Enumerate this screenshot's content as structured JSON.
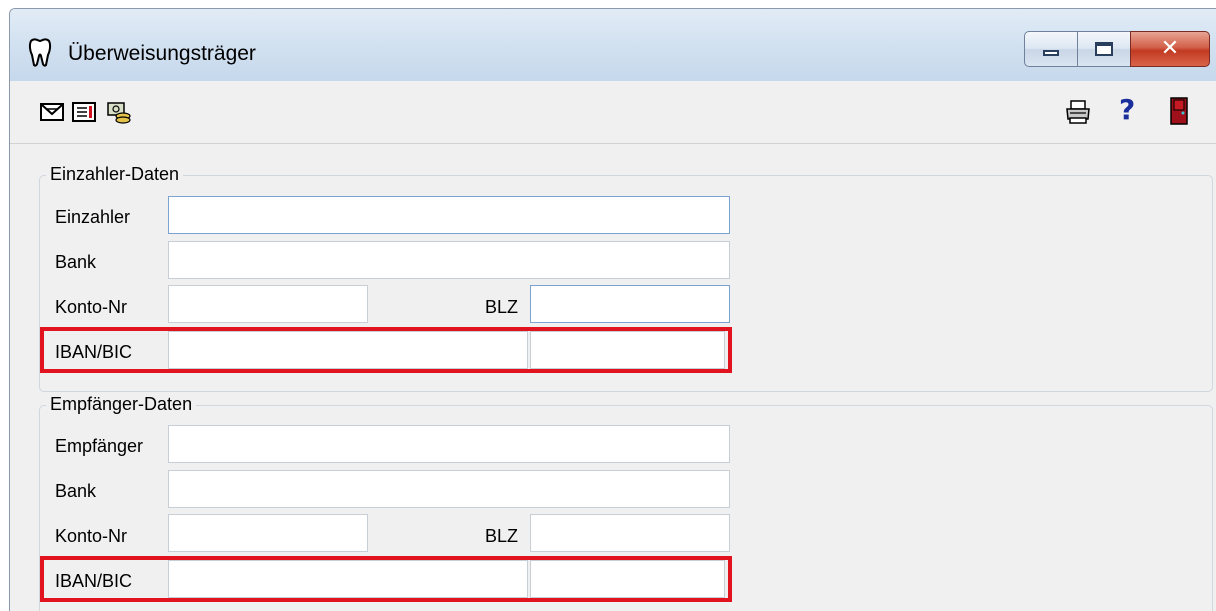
{
  "window": {
    "title": "Überweisungsträger",
    "icon": "tooth-icon",
    "controls": {
      "minimize": "minimize-icon",
      "maximize": "maximize-icon",
      "close": "✕"
    }
  },
  "toolbar": {
    "left_icons": [
      "envelope-icon",
      "document-icon",
      "money-icon"
    ],
    "right_icons": [
      "printer-icon",
      "help-icon",
      "exit-door-icon"
    ],
    "help_glyph": "?"
  },
  "payer": {
    "group_title": "Einzahler-Daten",
    "name_label": "Einzahler",
    "name_value": "",
    "bank_label": "Bank",
    "bank_value": "",
    "account_label": "Konto-Nr",
    "account_value": "",
    "blz_label": "BLZ",
    "blz_value": "",
    "iban_label": "IBAN/BIC",
    "iban_value": "",
    "bic_value": ""
  },
  "recipient": {
    "group_title": "Empfänger-Daten",
    "name_label": "Empfänger",
    "name_value": "",
    "bank_label": "Bank",
    "bank_value": "",
    "account_label": "Konto-Nr",
    "account_value": "",
    "blz_label": "BLZ",
    "blz_value": "",
    "iban_label": "IBAN/BIC",
    "iban_value": "",
    "bic_value": ""
  },
  "colors": {
    "highlight": "#e0131f",
    "accent_help": "#1a2f9b",
    "exit_door": "#a0101a"
  }
}
